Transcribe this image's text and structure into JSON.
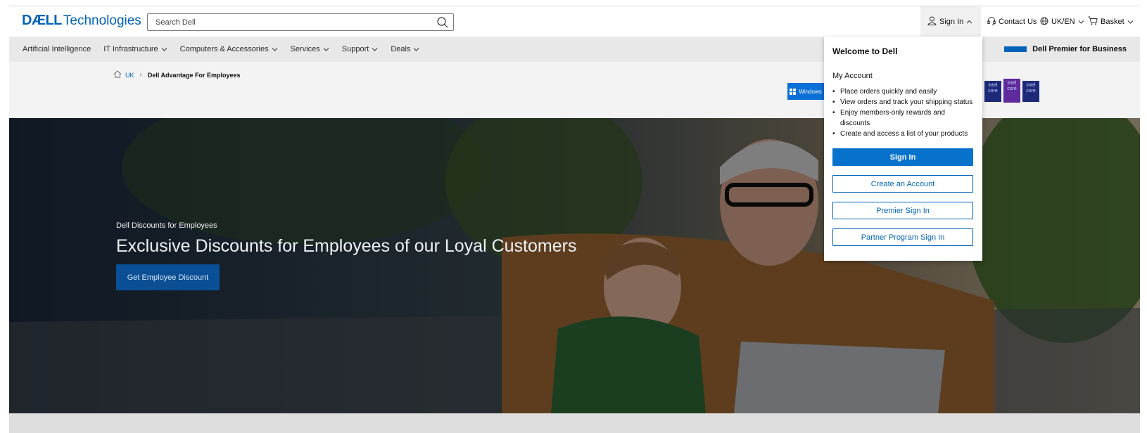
{
  "header": {
    "logo_bold": "DÆLL",
    "logo_light": "Technologies",
    "search_placeholder": "Search Dell",
    "sign_in": "Sign In",
    "contact_us": "Contact Us",
    "locale": "UK/EN",
    "basket": "Basket"
  },
  "nav": {
    "items": [
      "Artificial Intelligence",
      "IT Infrastructure",
      "Computers & Accessories",
      "Services",
      "Support",
      "Deals"
    ],
    "premier": "Dell Premier for Business"
  },
  "breadcrumb": {
    "home": "UK",
    "current": "Dell Advantage For Employees"
  },
  "badges": {
    "windows": "Windows",
    "intel": "intel core"
  },
  "hero": {
    "kicker": "Dell Discounts for Employees",
    "title": "Exclusive Discounts for Employees of our Loyal Customers",
    "cta": "Get Employee Discount"
  },
  "dropdown": {
    "title": "Welcome to Dell",
    "account_heading": "My Account",
    "benefits": [
      "Place orders quickly and easily",
      "View orders and track your shipping status",
      "Enjoy members-only rewards and discounts",
      "Create and access a list of your products"
    ],
    "sign_in_button": "Sign In",
    "create_account_button": "Create an Account",
    "premier_sign_in_button": "Premier Sign In",
    "partner_sign_in_button": "Partner Program Sign In"
  },
  "colors": {
    "brand_blue": "#0063b8",
    "primary_button": "#0672cb",
    "hero_cta": "#0a4f95",
    "nav_bg": "#e8e8e8"
  },
  "icons": [
    "search-icon",
    "user-icon",
    "chevron-up-icon",
    "headset-icon",
    "globe-icon",
    "cart-icon",
    "chevron-down-icon",
    "home-icon",
    "windows-icon"
  ]
}
